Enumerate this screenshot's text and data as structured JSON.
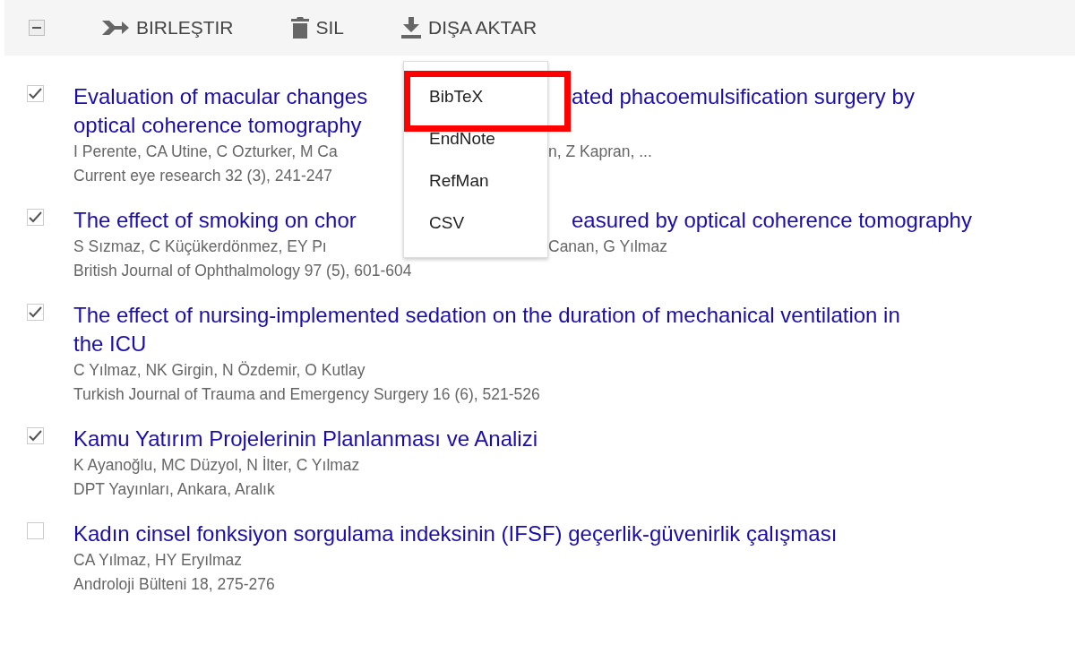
{
  "toolbar": {
    "select_all": {
      "indeterminate": true
    },
    "buttons": [
      {
        "kind": "merge",
        "label": "BIRLEŞTIR"
      },
      {
        "kind": "delete",
        "label": "SIL"
      },
      {
        "kind": "export",
        "label": "DIŞA AKTAR"
      }
    ]
  },
  "export_menu": {
    "items": [
      {
        "label": "BibTeX",
        "highlighted": true
      },
      {
        "label": "EndNote",
        "highlighted": false
      },
      {
        "label": "RefMan",
        "highlighted": false
      },
      {
        "label": "CSV",
        "highlighted": false
      }
    ]
  },
  "articles": [
    {
      "checked": true,
      "title_lines": [
        [
          "Evaluation of macular changes",
          "ated phacoemulsification surgery by"
        ],
        [
          "optical coherence tomography"
        ]
      ],
      "authors": [
        "I Perente, CA Utine, C Ozturker, M Ca",
        "n, Z Kapran, ..."
      ],
      "source": [
        "Current eye research 32 (3), 241-247"
      ]
    },
    {
      "checked": true,
      "title_lines": [
        [
          "The effect of smoking on chor",
          "easured by optical coherence tomography"
        ]
      ],
      "authors": [
        "S Sızmaz, C Küçükerdönmez, EY Pı",
        "Canan, G Yılmaz"
      ],
      "source": [
        "British Journal of Ophthalmology 97 (5), 601-604"
      ]
    },
    {
      "checked": true,
      "title_lines": [
        [
          "The effect of nursing-implemented sedation on the duration of mechanical ventilation in"
        ],
        [
          "the ICU"
        ]
      ],
      "authors": [
        "C Yılmaz, NK Girgin, N Özdemir, O Kutlay"
      ],
      "source": [
        "Turkish Journal of Trauma and Emergency Surgery 16 (6), 521-526"
      ]
    },
    {
      "checked": true,
      "title_lines": [
        [
          "Kamu Yatırım Projelerinin Planlanması ve Analizi"
        ]
      ],
      "authors": [
        "K Ayanoğlu, MC Düzyol, N İlter, C Yılmaz"
      ],
      "source": [
        "DPT Yayınları, Ankara, Aralık"
      ]
    },
    {
      "checked": false,
      "title_lines": [
        [
          "Kadın cinsel fonksiyon sorgulama indeksinin (IFSF) geçerlik-güvenirlik çalışması"
        ]
      ],
      "authors": [
        "CA Yılmaz, HY Eryılmaz"
      ],
      "source": [
        "Androloji Bülteni 18, 275-276"
      ]
    }
  ]
}
